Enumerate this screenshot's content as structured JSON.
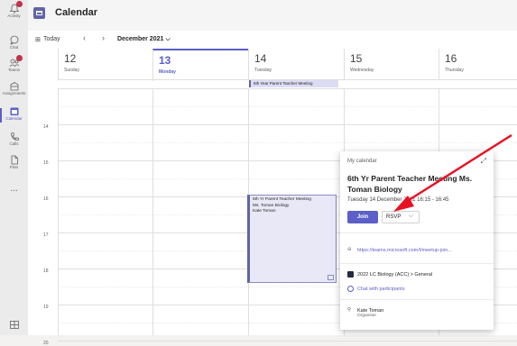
{
  "rail": {
    "items": [
      {
        "label": "Activity",
        "icon": "bell-icon",
        "badge": true
      },
      {
        "label": "Chat",
        "icon": "chat-icon",
        "badge": false
      },
      {
        "label": "Teams",
        "icon": "teams-icon",
        "badge": true
      },
      {
        "label": "Assignments",
        "icon": "assignments-icon",
        "badge": false
      },
      {
        "label": "Calendar",
        "icon": "calendar-icon",
        "badge": false,
        "active": true
      },
      {
        "label": "Calls",
        "icon": "phone-icon",
        "badge": false
      },
      {
        "label": "Files",
        "icon": "files-icon",
        "badge": false
      },
      {
        "label": "...",
        "icon": "more-icon",
        "badge": false
      }
    ],
    "bottom_icon": "apps-icon"
  },
  "header": {
    "title": "Calendar"
  },
  "toolbar": {
    "today": "Today",
    "month": "December 2021"
  },
  "days": [
    {
      "num": "12",
      "name": "Sunday"
    },
    {
      "num": "13",
      "name": "Monday",
      "today": true
    },
    {
      "num": "14",
      "name": "Tuesday"
    },
    {
      "num": "15",
      "name": "Wednesday"
    },
    {
      "num": "16",
      "name": "Thursday"
    }
  ],
  "allday_event": "6th Year Parent Teacher Meeting",
  "hours": [
    "14",
    "15",
    "16",
    "17",
    "18",
    "19",
    "20"
  ],
  "event": {
    "line1": "6th Yr Parent Teacher Meeting",
    "line2": "Ms. Toman Biology",
    "line3": "Kate Toman"
  },
  "popup": {
    "calendar_label": "My calendar",
    "title": "6th Yr Parent Teacher Meeting Ms. Toman Biology",
    "time": "Tuesday 14 December 2021 16:15 - 16:45",
    "join": "Join",
    "rsvp": "RSVP",
    "link": "https://teams.microsoft.com/l/meetup-join...",
    "channel": "2022 LC Biology (ACC) > General",
    "chat": "Chat with participants",
    "organizer_name": "Kate Toman",
    "organizer_role": "Organiser"
  },
  "colors": {
    "accent": "#5b5fc7",
    "arrow": "#e81123"
  }
}
